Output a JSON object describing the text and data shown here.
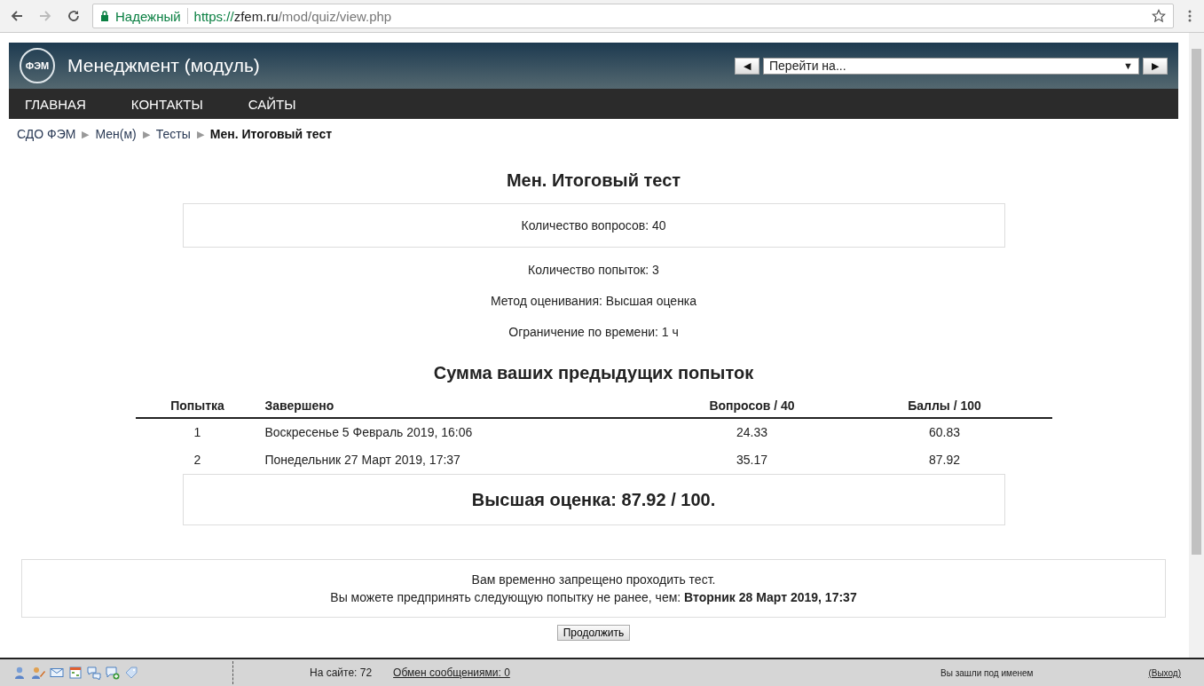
{
  "browser": {
    "security_label": "Надежный",
    "url_scheme": "https://",
    "url_host": "zfem.ru",
    "url_path": "/mod/quiz/view.php"
  },
  "header": {
    "logo_text": "ФЭМ",
    "title": "Менеджмент (модуль)",
    "jump_placeholder": "Перейти на...",
    "prev_button": "◀",
    "next_button": "▶",
    "dropdown_arrow": "▼"
  },
  "nav": [
    {
      "label": "ГЛАВНАЯ"
    },
    {
      "label": "КОНТАКТЫ"
    },
    {
      "label": "САЙТЫ"
    }
  ],
  "breadcrumbs": [
    {
      "label": "СДО ФЭМ",
      "current": false
    },
    {
      "label": "Мен(м)",
      "current": false
    },
    {
      "label": "Тесты",
      "current": false
    },
    {
      "label": "Мен. Итоговый тест",
      "current": true
    }
  ],
  "breadcrumb_separator": "▶",
  "quiz": {
    "title": "Мен. Итоговый тест",
    "question_count": "Количество вопросов: 40",
    "info": [
      "Количество попыток: 3",
      "Метод оценивания: Высшая оценка",
      "Ограничение по времени: 1 ч"
    ]
  },
  "attempts": {
    "title": "Сумма ваших предыдущих попыток",
    "columns": [
      "Попытка",
      "Завершено",
      "Вопросов / 40",
      "Баллы / 100"
    ],
    "rows": [
      [
        "1",
        "Воскресенье 5 Февраль 2019, 16:06",
        "24.33",
        "60.83"
      ],
      [
        "2",
        "Понедельник 27 Март 2019, 17:37",
        "35.17",
        "87.92"
      ]
    ],
    "best": "Высшая оценка: 87.92 / 100."
  },
  "notice": {
    "line1": "Вам временно запрещено проходить тест.",
    "line2": "Вы можете предпринять следующую попытку не ранее, чем: **Вторник 28 Март 2019, 17:37**"
  },
  "continue_button": "Продолжить",
  "footer": {
    "online": "На сайте: 72",
    "messages": "Обмен сообщениями: 0",
    "logged_in": "Вы зашли под именем",
    "logout": "(Выход)"
  }
}
